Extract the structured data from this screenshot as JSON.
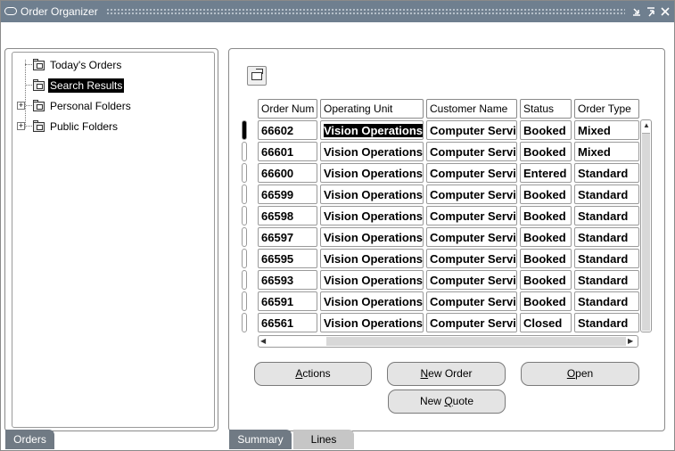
{
  "window": {
    "title": "Order Organizer",
    "controls": [
      "minimize-icon",
      "maximize-icon",
      "close-icon"
    ]
  },
  "tree": {
    "items": [
      {
        "label": "Today's Orders",
        "icon": "folder-search-icon",
        "selected": false,
        "expandable": false
      },
      {
        "label": "Search Results",
        "icon": "folder-results-icon",
        "selected": true,
        "expandable": false
      },
      {
        "label": "Personal Folders",
        "icon": "folder-personal-icon",
        "selected": false,
        "expandable": true
      },
      {
        "label": "Public Folders",
        "icon": "folder-public-icon",
        "selected": false,
        "expandable": true
      }
    ]
  },
  "table": {
    "columns": [
      "Order Num",
      "Operating Unit",
      "Customer Name",
      "Status",
      "Order Type"
    ],
    "rows": [
      [
        "66602",
        "Vision Operations",
        "Computer Servi",
        "Booked",
        "Mixed"
      ],
      [
        "66601",
        "Vision Operations",
        "Computer Servi",
        "Booked",
        "Mixed"
      ],
      [
        "66600",
        "Vision Operations",
        "Computer Servi",
        "Entered",
        "Standard"
      ],
      [
        "66599",
        "Vision Operations",
        "Computer Servi",
        "Booked",
        "Standard"
      ],
      [
        "66598",
        "Vision Operations",
        "Computer Servi",
        "Booked",
        "Standard"
      ],
      [
        "66597",
        "Vision Operations",
        "Computer Servi",
        "Booked",
        "Standard"
      ],
      [
        "66595",
        "Vision Operations",
        "Computer Servi",
        "Booked",
        "Standard"
      ],
      [
        "66593",
        "Vision Operations",
        "Computer Servi",
        "Booked",
        "Standard"
      ],
      [
        "66591",
        "Vision Operations",
        "Computer Servi",
        "Booked",
        "Standard"
      ],
      [
        "66561",
        "Vision Operations",
        "Computer Servi",
        "Closed",
        "Standard"
      ]
    ],
    "current_row": 0
  },
  "buttons": {
    "actions": {
      "pre": "",
      "mnemonic": "A",
      "post": "ctions"
    },
    "new_order": {
      "pre": "",
      "mnemonic": "N",
      "post": "ew Order"
    },
    "open": {
      "pre": "",
      "mnemonic": "O",
      "post": "pen"
    },
    "new_quote": {
      "pre": "New ",
      "mnemonic": "Q",
      "post": "uote"
    }
  },
  "tabs": {
    "left": [
      {
        "label": "Orders",
        "active": true
      }
    ],
    "right": [
      {
        "label": "Summary",
        "active": true
      },
      {
        "label": "Lines",
        "active": false
      }
    ]
  },
  "colors": {
    "titlebar": "#6f7f8f",
    "active_tab": "#707a84",
    "inactive_tab": "#c6c6c6",
    "button_face": "#e4e4e4"
  }
}
